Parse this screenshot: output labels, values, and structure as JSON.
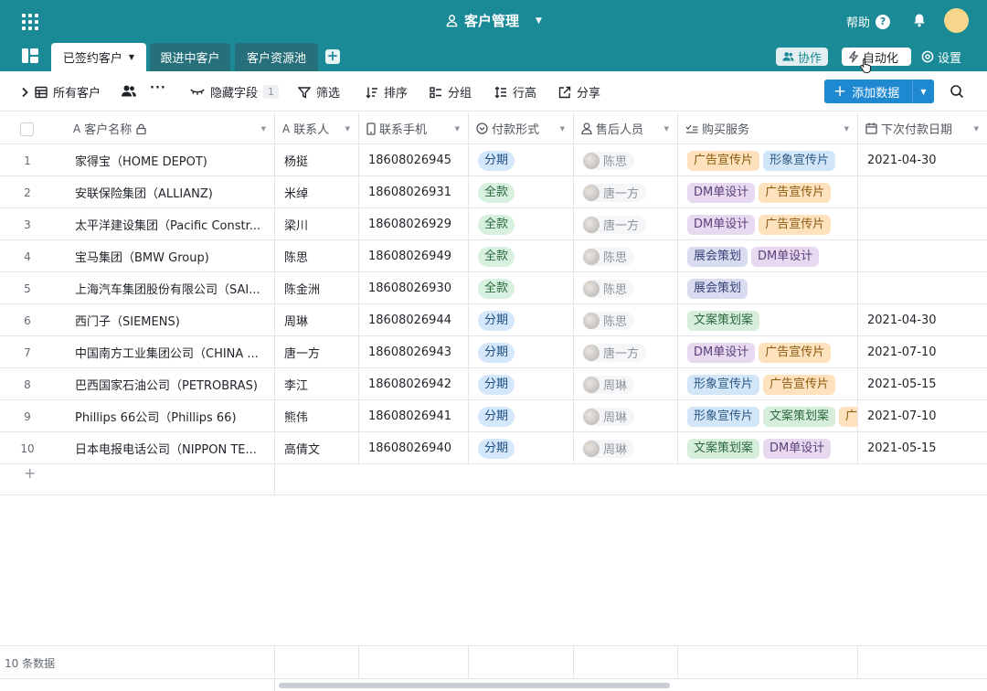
{
  "header": {
    "title": "客户管理",
    "help_label": "帮助",
    "help_icon": "?"
  },
  "tabs": [
    {
      "label": "已签约客户",
      "active": true
    },
    {
      "label": "跟进中客户",
      "active": false
    },
    {
      "label": "客户资源池",
      "active": false
    }
  ],
  "header_actions": {
    "collab": "协作",
    "automation": "自动化",
    "settings": "设置"
  },
  "toolbar": {
    "view_name": "所有客户",
    "hidden_fields": "隐藏字段",
    "hidden_count": "1",
    "filter": "筛选",
    "sort": "排序",
    "group": "分组",
    "row_height": "行高",
    "share": "分享",
    "add_data": "添加数据"
  },
  "columns": [
    {
      "label": "客户名称",
      "type_icon": "text-icon"
    },
    {
      "label": "联系人",
      "type_icon": "text-icon"
    },
    {
      "label": "联系手机",
      "type_icon": "phone-icon"
    },
    {
      "label": "付款形式",
      "type_icon": "single-select-icon"
    },
    {
      "label": "售后人员",
      "type_icon": "person-icon"
    },
    {
      "label": "购买服务",
      "type_icon": "multi-select-icon"
    },
    {
      "label": "下次付款日期",
      "type_icon": "calendar-icon"
    }
  ],
  "rows": [
    {
      "num": "1",
      "name": "家得宝（HOME DEPOT)",
      "contact": "杨挺",
      "phone": "18608026945",
      "pay": "分期",
      "staff": "陈思",
      "services": [
        "广告宣传片",
        "形象宣传片"
      ],
      "date": "2021-04-30"
    },
    {
      "num": "2",
      "name": "安联保险集团（ALLIANZ)",
      "contact": "米绰",
      "phone": "18608026931",
      "pay": "全款",
      "staff": "唐一方",
      "services": [
        "DM单设计",
        "广告宣传片"
      ],
      "date": ""
    },
    {
      "num": "3",
      "name": "太平洋建设集团（Pacific Constr...",
      "contact": "梁川",
      "phone": "18608026929",
      "pay": "全款",
      "staff": "唐一方",
      "services": [
        "DM单设计",
        "广告宣传片"
      ],
      "date": ""
    },
    {
      "num": "4",
      "name": "宝马集团（BMW Group)",
      "contact": "陈思",
      "phone": "18608026949",
      "pay": "全款",
      "staff": "陈思",
      "services": [
        "展会策划",
        "DM单设计"
      ],
      "date": ""
    },
    {
      "num": "5",
      "name": "上海汽车集团股份有限公司（SAI...",
      "contact": "陈金洲",
      "phone": "18608026930",
      "pay": "全款",
      "staff": "陈思",
      "services": [
        "展会策划"
      ],
      "date": ""
    },
    {
      "num": "6",
      "name": "西门子（SIEMENS)",
      "contact": "周琳",
      "phone": "18608026944",
      "pay": "分期",
      "staff": "陈思",
      "services": [
        "文案策划案"
      ],
      "date": "2021-04-30"
    },
    {
      "num": "7",
      "name": "中国南方工业集团公司（CHINA ...",
      "contact": "唐一方",
      "phone": "18608026943",
      "pay": "分期",
      "staff": "唐一方",
      "services": [
        "DM单设计",
        "广告宣传片"
      ],
      "date": "2021-07-10"
    },
    {
      "num": "8",
      "name": "巴西国家石油公司（PETROBRAS)",
      "contact": "李江",
      "phone": "18608026942",
      "pay": "分期",
      "staff": "周琳",
      "services": [
        "形象宣传片",
        "广告宣传片"
      ],
      "date": "2021-05-15"
    },
    {
      "num": "9",
      "name": "Phillips 66公司（Phillips 66)",
      "contact": "熊伟",
      "phone": "18608026941",
      "pay": "分期",
      "staff": "周琳",
      "services": [
        "形象宣传片",
        "文案策划案",
        "广"
      ],
      "date": "2021-07-10"
    },
    {
      "num": "10",
      "name": "日本电报电话公司（NIPPON TE...",
      "contact": "高倩文",
      "phone": "18608026940",
      "pay": "分期",
      "staff": "周琳",
      "services": [
        "文案策划案",
        "DM单设计"
      ],
      "date": "2021-05-15"
    }
  ],
  "footer": {
    "record_count": "10 条数据"
  },
  "colors": {
    "header_bg": "#1a8a96",
    "primary_button": "#1e88d0",
    "pay_分期": "#d5e7fb",
    "pay_全款": "#d8f0e0",
    "svc_广告宣传片": "#fde2bd",
    "svc_形象宣传片": "#d2e6f8",
    "svc_DM单设计": "#e6d9f0",
    "svc_展会策划": "#d9dcf0",
    "svc_文案策划案": "#d7eedd"
  }
}
